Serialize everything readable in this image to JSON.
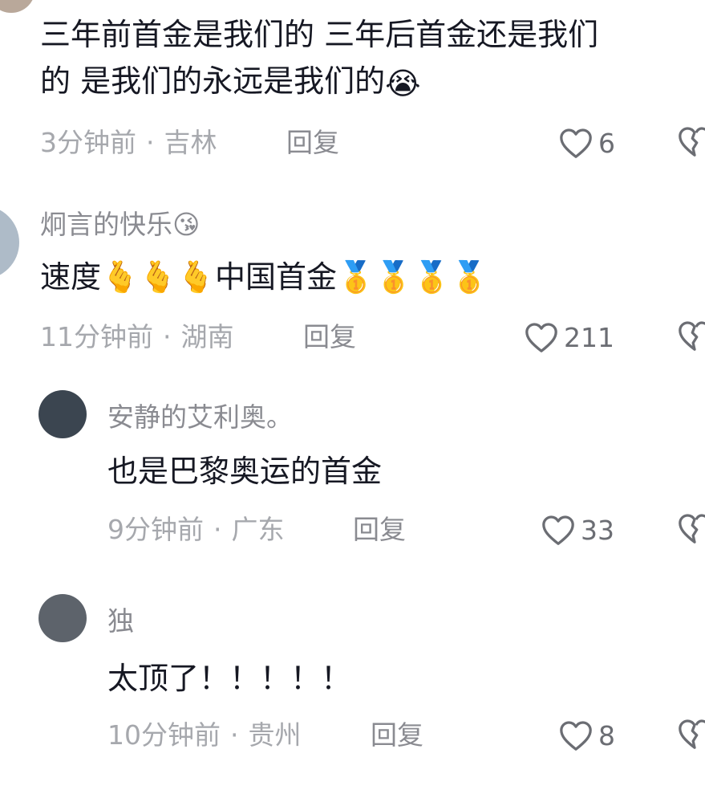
{
  "comments": [
    {
      "username": "",
      "content_line1": "三年前首金是我们的 三年后首金还是我们",
      "content_line2": "的 是我们的永远是我们的",
      "content_emoji": "😭",
      "time": "3分钟前",
      "location": "吉林",
      "reply_label": "回复",
      "likes": "6"
    },
    {
      "username": "炯言的快乐",
      "username_emoji": "😘",
      "content_text_a": "速度",
      "content_emoji_a": "🫰🫰🫰",
      "content_text_b": "中国首金",
      "content_emoji_b": "🥇🥇🥇🥇",
      "time": "11分钟前",
      "location": "湖南",
      "reply_label": "回复",
      "likes": "211"
    },
    {
      "username": "安静的艾利奥。",
      "content": "也是巴黎奥运的首金",
      "time": "9分钟前",
      "location": "广东",
      "reply_label": "回复",
      "likes": "33"
    },
    {
      "username": "独",
      "content": "太顶了！！！！！",
      "time": "10分钟前",
      "location": "贵州",
      "reply_label": "回复",
      "likes": "8"
    }
  ],
  "icons": {
    "like": "heart-outline-icon",
    "dislike": "broken-heart-icon"
  },
  "colors": {
    "text_primary": "#161823",
    "text_secondary": "#8a8b91",
    "text_meta": "#a6a8ad"
  }
}
